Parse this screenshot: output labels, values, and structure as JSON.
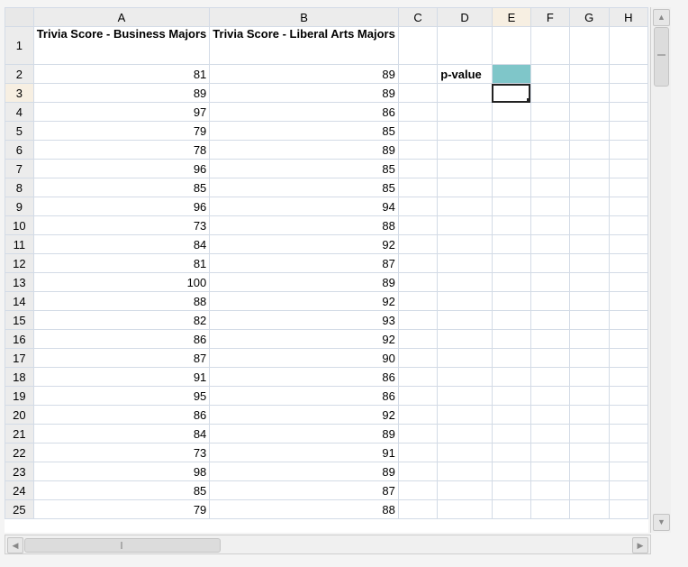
{
  "columns": [
    "A",
    "B",
    "C",
    "D",
    "E",
    "F",
    "G",
    "H"
  ],
  "active_column": "E",
  "active_row": "3",
  "header_row": {
    "row": "1",
    "a": "Trivia Score - Business Majors",
    "b": "Trivia Score - Liberal Arts Majors"
  },
  "label_cell": "p-value",
  "rows": [
    {
      "row": "2",
      "a": "81",
      "b": "89"
    },
    {
      "row": "3",
      "a": "89",
      "b": "89"
    },
    {
      "row": "4",
      "a": "97",
      "b": "86"
    },
    {
      "row": "5",
      "a": "79",
      "b": "85"
    },
    {
      "row": "6",
      "a": "78",
      "b": "89"
    },
    {
      "row": "7",
      "a": "96",
      "b": "85"
    },
    {
      "row": "8",
      "a": "85",
      "b": "85"
    },
    {
      "row": "9",
      "a": "96",
      "b": "94"
    },
    {
      "row": "10",
      "a": "73",
      "b": "88"
    },
    {
      "row": "11",
      "a": "84",
      "b": "92"
    },
    {
      "row": "12",
      "a": "81",
      "b": "87"
    },
    {
      "row": "13",
      "a": "100",
      "b": "89"
    },
    {
      "row": "14",
      "a": "88",
      "b": "92"
    },
    {
      "row": "15",
      "a": "82",
      "b": "93"
    },
    {
      "row": "16",
      "a": "86",
      "b": "92"
    },
    {
      "row": "17",
      "a": "87",
      "b": "90"
    },
    {
      "row": "18",
      "a": "91",
      "b": "86"
    },
    {
      "row": "19",
      "a": "95",
      "b": "86"
    },
    {
      "row": "20",
      "a": "86",
      "b": "92"
    },
    {
      "row": "21",
      "a": "84",
      "b": "89"
    },
    {
      "row": "22",
      "a": "73",
      "b": "91"
    },
    {
      "row": "23",
      "a": "98",
      "b": "89"
    },
    {
      "row": "24",
      "a": "85",
      "b": "87"
    },
    {
      "row": "25",
      "a": "79",
      "b": "88"
    }
  ],
  "colors": {
    "highlight_fill": "#7fc6c9",
    "active_header": "#f7efe2"
  },
  "icons": {
    "scroll_up": "triangle-up",
    "scroll_down": "triangle-down",
    "scroll_left": "triangle-left",
    "scroll_right": "triangle-right"
  }
}
